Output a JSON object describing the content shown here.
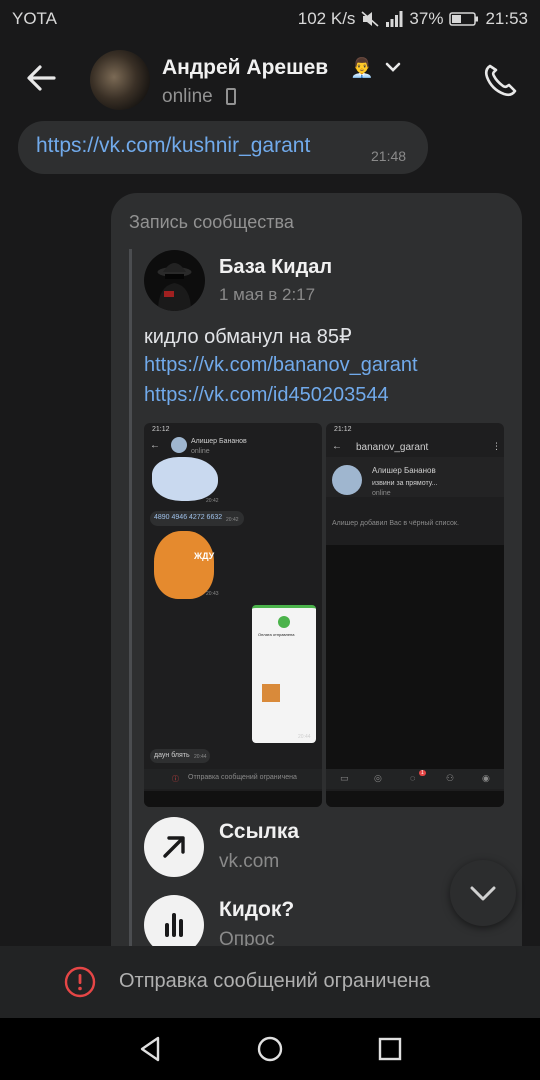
{
  "status_bar": {
    "carrier": "YOTA",
    "speed": "102 K/s",
    "battery": "37%",
    "time": "21:53"
  },
  "header": {
    "name": "Андрей Арешев",
    "name_emoji": "👨‍💼",
    "status": "online"
  },
  "messages": {
    "link_message": {
      "text": "https://vk.com/kushnir_garant",
      "time": "21:48"
    },
    "post": {
      "caption": "Запись сообщества",
      "author": "База Кидал",
      "date": "1 мая в 2:17",
      "text": "кидло обманул на 85₽",
      "link1": "https://vk.com/bananov_garant",
      "link2": "https://vk.com/id450203544",
      "shot_left": {
        "time": "21:12",
        "name": "Алишер Бананов",
        "status": "online",
        "msg_time1": "20:42",
        "card_number": "4890 4946 4272 6632",
        "msg_time2": "20:42",
        "sticker_text": "ЖДУ",
        "msg_time3": "20:43",
        "pay_title": "Оплата отправлена",
        "photo_time": "20:44",
        "last_msg": "даун блять",
        "last_time": "20:44",
        "restricted": "Отправка сообщений ограничена"
      },
      "shot_right": {
        "time": "21:12",
        "title": "bananov_garant",
        "name": "Алишер Бананов",
        "preview": "извини за прямоту...",
        "status": "online",
        "notice": "Алишер добавил Вас в чёрный список.",
        "badge": "1"
      },
      "attachments": [
        {
          "title": "Ссылка",
          "subtitle": "vk.com",
          "icon": "arrow-up-right-icon"
        },
        {
          "title": "Кидок?",
          "subtitle": "Опрос",
          "icon": "poll-bars-icon"
        }
      ]
    }
  },
  "restricted_bar": {
    "text": "Отправка сообщений ограничена"
  },
  "colors": {
    "background": "#19191a",
    "bubble": "#2e2f30",
    "link": "#71aaeb",
    "alert_red": "#e64646"
  }
}
